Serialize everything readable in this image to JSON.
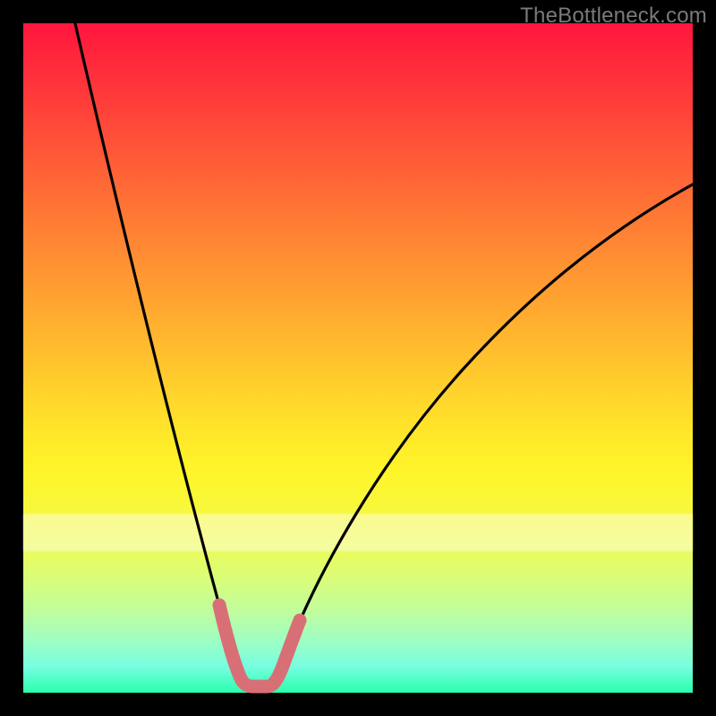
{
  "watermark": "TheBottleneck.com",
  "chart_data": {
    "type": "line",
    "title": "",
    "xlabel": "",
    "ylabel": "",
    "xlim": [
      0,
      100
    ],
    "ylim": [
      0,
      100
    ],
    "grid": false,
    "legend": "none",
    "series": [
      {
        "name": "bottleneck-curve",
        "x": [
          0,
          5,
          10,
          15,
          18,
          21,
          24,
          27,
          29,
          30,
          31,
          32,
          33,
          34,
          35,
          36,
          38,
          40,
          43,
          47,
          52,
          58,
          65,
          73,
          82,
          91,
          100
        ],
        "values": [
          120,
          100,
          82,
          64,
          53,
          42,
          31,
          20,
          12,
          9,
          6,
          3,
          1,
          0.5,
          1,
          3,
          6.5,
          11,
          17,
          24,
          32,
          40,
          48,
          56,
          63,
          70,
          77
        ]
      },
      {
        "name": "highlight-band",
        "x": [
          29,
          30,
          31,
          32,
          33,
          34,
          35,
          36,
          38
        ],
        "values": [
          12,
          9,
          6,
          3,
          1,
          0.8,
          1.3,
          3,
          6.5
        ]
      }
    ],
    "colors": {
      "curve": "#000000",
      "highlight": "#d96f76",
      "background_top": "#ff163d",
      "background_bottom": "#2bffad"
    }
  }
}
